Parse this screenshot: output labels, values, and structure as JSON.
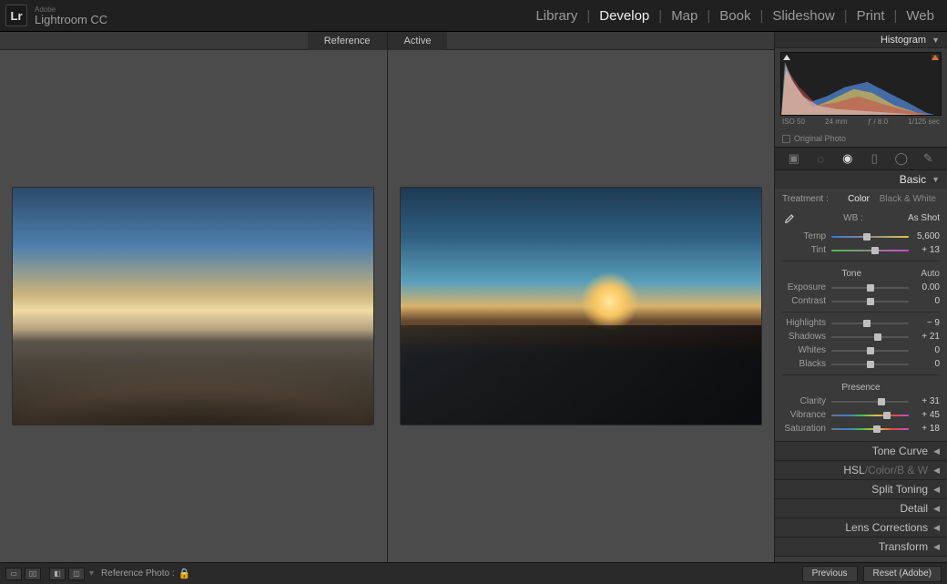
{
  "brand": {
    "adobe": "Adobe",
    "product": "Lightroom CC",
    "logo": "Lr"
  },
  "modules": [
    "Library",
    "Develop",
    "Map",
    "Book",
    "Slideshow",
    "Print",
    "Web"
  ],
  "active_module": "Develop",
  "canvas_tabs": {
    "reference": "Reference",
    "active": "Active"
  },
  "histogram": {
    "title": "Histogram",
    "iso": "ISO 50",
    "focal": "24 mm",
    "aperture": "ƒ / 8.0",
    "shutter": "1/125 sec",
    "original_photo": "Original Photo"
  },
  "tools": [
    "crop",
    "spot",
    "redeye",
    "grad",
    "radial",
    "brush"
  ],
  "active_tool": "redeye",
  "basic": {
    "title": "Basic",
    "treatment_label": "Treatment :",
    "treatment_options": {
      "color": "Color",
      "bw": "Black & White"
    },
    "active_treatment": "color",
    "wb_label": "WB :",
    "wb_value": "As Shot",
    "temp": {
      "label": "Temp",
      "value": "5,600",
      "pos": 46
    },
    "tint": {
      "label": "Tint",
      "value": "+ 13",
      "pos": 56
    },
    "tone_label": "Tone",
    "auto_label": "Auto",
    "exposure": {
      "label": "Exposure",
      "value": "0.00",
      "pos": 50
    },
    "contrast": {
      "label": "Contrast",
      "value": "0",
      "pos": 50
    },
    "highlights": {
      "label": "Highlights",
      "value": "− 9",
      "pos": 46
    },
    "shadows": {
      "label": "Shadows",
      "value": "+ 21",
      "pos": 60
    },
    "whites": {
      "label": "Whites",
      "value": "0",
      "pos": 50
    },
    "blacks": {
      "label": "Blacks",
      "value": "0",
      "pos": 50
    },
    "presence_label": "Presence",
    "clarity": {
      "label": "Clarity",
      "value": "+ 31",
      "pos": 65
    },
    "vibrance": {
      "label": "Vibrance",
      "value": "+ 45",
      "pos": 72
    },
    "saturation": {
      "label": "Saturation",
      "value": "+ 18",
      "pos": 59
    }
  },
  "collapsed_panels": {
    "tone_curve": "Tone Curve",
    "hsl": "HSL",
    "hsl_sep": " / ",
    "hsl_color": "Color",
    "hsl_bw": "B & W",
    "split": "Split Toning",
    "detail": "Detail",
    "lens": "Lens Corrections",
    "transform": "Transform"
  },
  "bottom": {
    "ref_label": "Reference Photo :",
    "previous": "Previous",
    "reset": "Reset (Adobe)"
  }
}
